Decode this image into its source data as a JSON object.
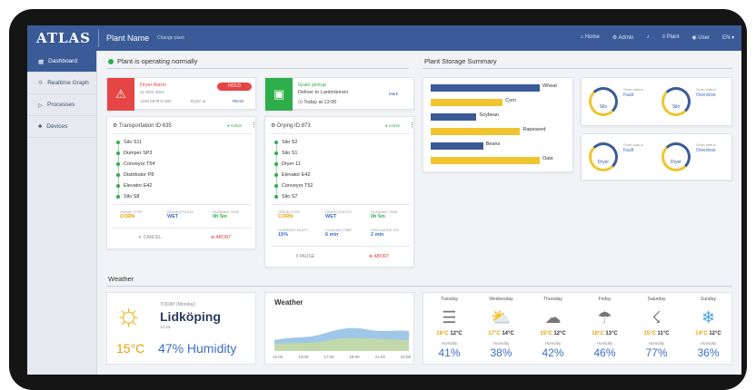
{
  "app": {
    "logo": "ATLAS",
    "plant_name": "Plant Name",
    "change_plant": "Change plant"
  },
  "nav": {
    "home": "Home",
    "admin": "Admin",
    "alerts": "",
    "plant": "Plant",
    "user": "User",
    "lang": "EN"
  },
  "sidebar": [
    {
      "label": "Dashboard",
      "icon": "dashboard-icon"
    },
    {
      "label": "Realtime Graph",
      "icon": "graph-icon"
    },
    {
      "label": "Processes",
      "icon": "play-icon"
    },
    {
      "label": "Devices",
      "icon": "devices-icon"
    }
  ],
  "status": {
    "text": "Plant is operating normally"
  },
  "alerts": {
    "dryer": {
      "title": "Dryer Alarm",
      "date": "11 NOV 2021",
      "meta1": "1234 5678 9 ABC",
      "meta2": "Dryer 11",
      "action": "READ",
      "button": "HOLD",
      "color": "#e64545"
    },
    "grain": {
      "title": "Grain pickup",
      "subtitle": "Deliver to Lantmännen",
      "time": "Today at 13:00",
      "action": "Mark",
      "color": "#2eae4a"
    }
  },
  "transport": {
    "title": "Transportation ID 635",
    "status": "Active",
    "items": [
      "Silo S11",
      "Dumper SP3",
      "Conveyor T54",
      "Distributor P8",
      "Elevator E42",
      "Silo S8"
    ],
    "stats": [
      {
        "label": "GRAIN TYPE",
        "value": "CORN"
      },
      {
        "label": "GRAIN STATUS",
        "value": "WET"
      },
      {
        "label": "RUNNING TIME",
        "value": "0h 5m"
      }
    ],
    "cancel": "CANCEL",
    "abort": "ABORT"
  },
  "drying": {
    "title": "Drying ID 873",
    "status": "Active",
    "items": [
      "Silo S2",
      "Silo S1",
      "Dryer 11",
      "Elevator E42",
      "Conveyor T52",
      "Silo S7"
    ],
    "stats": [
      {
        "label": "GRAIN TYPE",
        "value": "CORN"
      },
      {
        "label": "GRAIN STATUS",
        "value": "WET"
      },
      {
        "label": "RUNNING TIME",
        "value": "0h 5m"
      },
      {
        "label": "CURRENT MOIST.",
        "value": "15%"
      },
      {
        "label": "COOLING TIME",
        "value": "6 min"
      },
      {
        "label": "DISCHARGE INT.",
        "value": "2 min"
      }
    ],
    "pause": "PAUSE",
    "abort": "ABORT"
  },
  "storage": {
    "title": "Plant Storage Summary",
    "bars": [
      {
        "label": "Wheat",
        "value": 1.0,
        "color": "#3a5b97"
      },
      {
        "label": "Corn",
        "value": 0.66,
        "color": "#f0c530"
      },
      {
        "label": "Soybean",
        "value": 0.42,
        "color": "#3a5b97"
      },
      {
        "label": "Rapeseed",
        "value": 0.82,
        "color": "#f0c530"
      },
      {
        "label": "Beans",
        "value": 0.48,
        "color": "#3a5b97"
      },
      {
        "label": "Oats",
        "value": 1.0,
        "color": "#f0c530"
      }
    ]
  },
  "devices": [
    {
      "name": "Silo",
      "s1": "Grain status",
      "v1": "Fault",
      "s2": "Grain status",
      "v2": "Overdose"
    },
    {
      "name": "Silo",
      "s1": "Grain status",
      "v1": "Fault",
      "s2": "Grain status",
      "v2": "Overdose"
    },
    {
      "name": "Dryer",
      "s1": "Grain status",
      "v1": "Fault",
      "s2": "Grain status",
      "v2": "Overdose"
    },
    {
      "name": "Dryer",
      "s1": "Grain status",
      "v1": "Fault",
      "s2": "Grain status",
      "v2": "Overdose"
    }
  ],
  "weather": {
    "section": "Weather",
    "today_label": "TODAY (Monday)",
    "city": "Lidköping",
    "time": "12:33",
    "temp": "15°C",
    "humidity": "47% Humidity",
    "graph_title": "Weather",
    "graph_ticks": [
      "12:00",
      "13:00",
      "17:00",
      "19:00",
      "21:00",
      "23:00"
    ],
    "days": [
      {
        "name": "Tuesday",
        "hi": "16°C",
        "lo": "12°C",
        "pct": "41%",
        "icon": "fog-icon",
        "glyph": "☰"
      },
      {
        "name": "Wednesday",
        "hi": "17°C",
        "lo": "14°C",
        "pct": "38%",
        "icon": "partly-cloudy-icon",
        "glyph": "☁"
      },
      {
        "name": "Thursday",
        "hi": "15°C",
        "lo": "12°C",
        "pct": "42%",
        "icon": "cloud-icon",
        "glyph": "☁"
      },
      {
        "name": "Friday",
        "hi": "16°C",
        "lo": "13°C",
        "pct": "46%",
        "icon": "rain-icon",
        "glyph": "☂"
      },
      {
        "name": "Saturday",
        "hi": "15°C",
        "lo": "11°C",
        "pct": "77%",
        "icon": "thunder-icon",
        "glyph": "☇"
      },
      {
        "name": "Sunday",
        "hi": "14°C",
        "lo": "12°C",
        "pct": "36%",
        "icon": "snow-icon",
        "glyph": "❄"
      }
    ],
    "humidity_label": "Humidity"
  }
}
